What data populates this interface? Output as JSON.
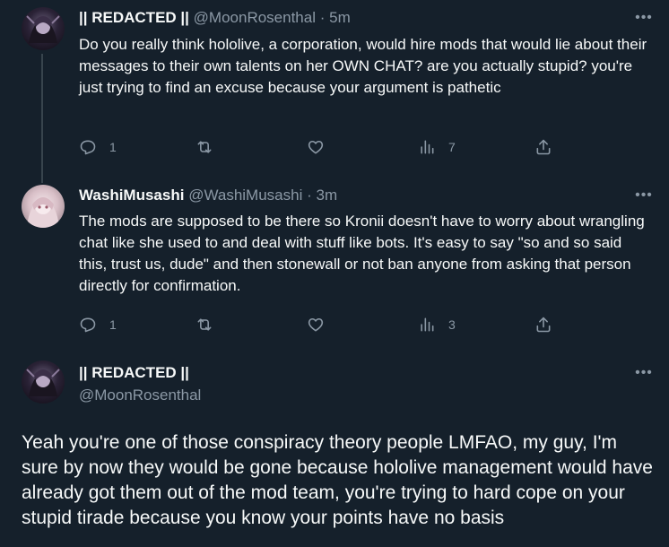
{
  "colors": {
    "background": "#15202b",
    "text": "#f7f9f9",
    "muted": "#8b98a5",
    "thread_line": "#38444d"
  },
  "tweets": [
    {
      "name": "|| REDACTED ||",
      "handle": "@MoonRosenthal",
      "separator": "·",
      "time": "5m",
      "text": "Do you really think hololive, a corporation, would hire mods that would lie about their messages to their own talents on her OWN CHAT? are you actually stupid? you're just trying to find an excuse because your argument is pathetic",
      "replies": "1",
      "views": "7",
      "avatar_icon": "dark-anime-avatar"
    },
    {
      "name": "WashiMusashi",
      "handle": "@WashiMusashi",
      "separator": "·",
      "time": "3m",
      "text": "The mods are supposed to be there so Kronii doesn't have to worry about wrangling chat like she used to and deal with stuff like bots. It's easy to say \"so and so said this, trust us, dude\" and then stonewall or not ban anyone from asking that person directly for confirmation.",
      "replies": "1",
      "views": "3",
      "avatar_icon": "light-anime-avatar"
    }
  ],
  "focus_tweet": {
    "name": "|| REDACTED ||",
    "handle": "@MoonRosenthal",
    "text": "Yeah you're one of those conspiracy theory people LMFAO, my guy, I'm sure by now they would be gone because hololive management would have already got them out of the mod team, you're trying to hard cope on your stupid tirade because you know your points have no basis",
    "avatar_icon": "dark-anime-avatar"
  },
  "icons": {
    "more": "more-icon",
    "reply": "reply-icon",
    "retweet": "retweet-icon",
    "like": "like-icon",
    "views": "views-icon",
    "share": "share-icon"
  },
  "more_glyph": "•••"
}
